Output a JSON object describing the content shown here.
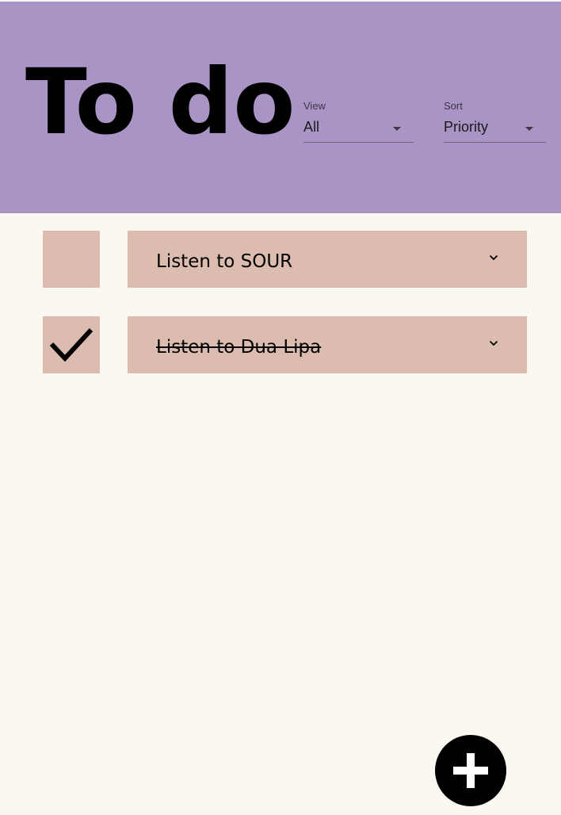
{
  "header": {
    "title": "To do",
    "background": "#a994c6"
  },
  "filters": {
    "view": {
      "label": "View",
      "value": "All"
    },
    "sort": {
      "label": "Sort",
      "value": "Priority"
    }
  },
  "tasks": [
    {
      "text": "Listen to SOUR",
      "completed": false,
      "expand_icon": "chevron-down-icon"
    },
    {
      "text": "Listen to Dua Lipa",
      "completed": true,
      "checkbox_icon": "checkmark-icon",
      "expand_icon": "chevron-down-icon"
    }
  ],
  "fab": {
    "icon": "plus-icon"
  },
  "colors": {
    "page_background": "#fbf7f1",
    "task_background": "#dcbcae",
    "fab_background": "#000000"
  }
}
